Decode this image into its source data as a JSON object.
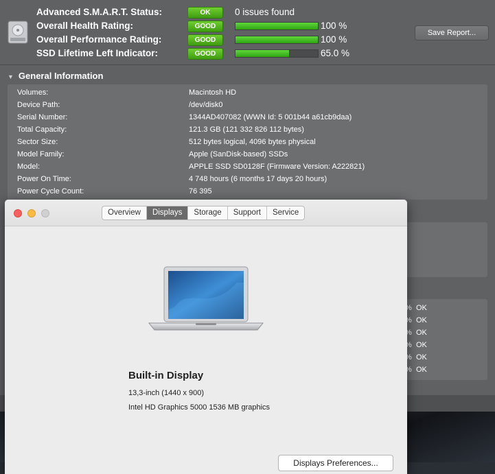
{
  "smart": {
    "rows": [
      {
        "label": "Advanced S.M.A.R.T. Status:",
        "badge": "OK",
        "text": "0 issues found"
      },
      {
        "label": "Overall Health Rating:",
        "badge": "GOOD",
        "percent_text": "100 %",
        "fill": 1.0
      },
      {
        "label": "Overall Performance Rating:",
        "badge": "GOOD",
        "percent_text": "100 %",
        "fill": 1.0
      },
      {
        "label": "SSD Lifetime Left Indicator:",
        "badge": "GOOD",
        "percent_text": "65.0 %",
        "fill": 0.65
      }
    ],
    "save_label": "Save Report..."
  },
  "general": {
    "title": "General Information",
    "rows": [
      {
        "key": "Volumes:",
        "value": "Macintosh HD"
      },
      {
        "key": "Device Path:",
        "value": "/dev/disk0"
      },
      {
        "key": "Serial Number:",
        "value": "1344AD407082 (WWN Id: 5 001b44 a61cb9daa)"
      },
      {
        "key": "Total Capacity:",
        "value": "121.3 GB (121 332 826 112 bytes)"
      },
      {
        "key": "Sector Size:",
        "value": "512 bytes logical, 4096 bytes physical"
      },
      {
        "key": "Model Family:",
        "value": "Apple (SanDisk-based) SSDs"
      },
      {
        "key": "Model:",
        "value": "APPLE SSD SD0128F  (Firmware Version: A222821)"
      },
      {
        "key": "Power On Time:",
        "value": "4 748 hours (6 months 17 days 20 hours)"
      },
      {
        "key": "Power Cycle Count:",
        "value": "76 395"
      }
    ]
  },
  "status_list": [
    {
      "pct": "%",
      "ok": "OK"
    },
    {
      "pct": "%",
      "ok": "OK"
    },
    {
      "pct": "%",
      "ok": "OK"
    },
    {
      "pct": "%",
      "ok": "OK"
    },
    {
      "pct": "%",
      "ok": "OK"
    },
    {
      "pct": "%",
      "ok": "OK"
    }
  ],
  "about": {
    "tabs": [
      "Overview",
      "Displays",
      "Storage",
      "Support",
      "Service"
    ],
    "active_tab": "Displays",
    "display_title": "Built-in Display",
    "display_size": "13,3-inch (1440 x 900)",
    "graphics": "Intel HD Graphics 5000 1536 MB graphics",
    "prefs_button": "Displays Preferences..."
  },
  "colors": {
    "badge_green": "#4caf1f",
    "bar_green": "#3cc21e",
    "active_tab": "#6b6b6b"
  }
}
